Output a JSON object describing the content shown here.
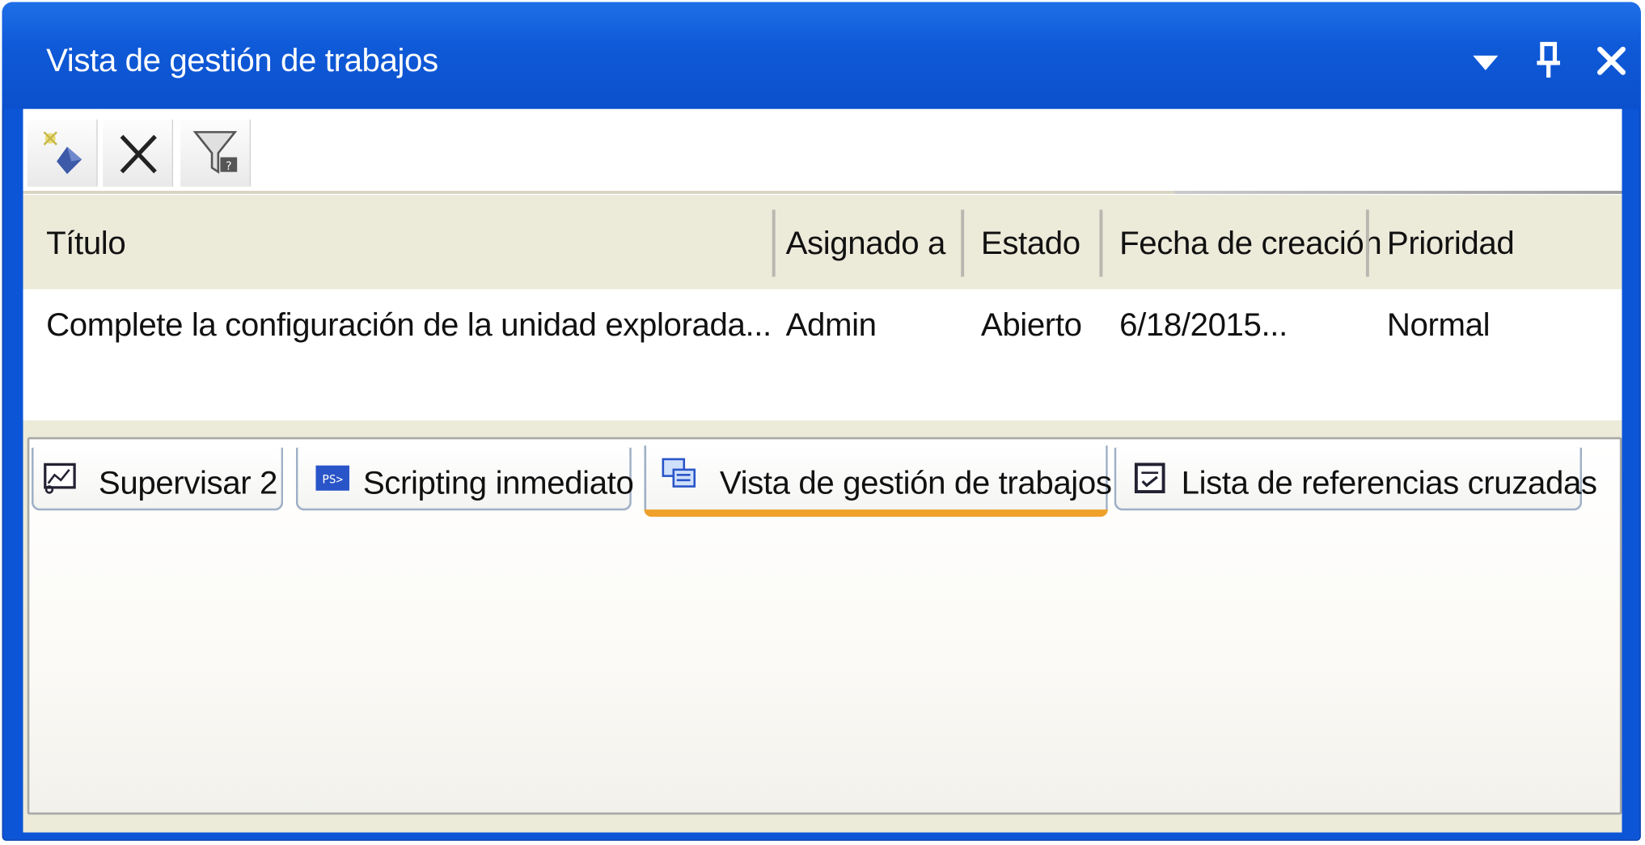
{
  "window": {
    "title": "Vista de gestión de trabajos",
    "controls": [
      "dropdown-icon",
      "pin-icon",
      "close-icon"
    ]
  },
  "toolbar": {
    "tools": [
      {
        "name": "new-job-icon"
      },
      {
        "name": "delete-icon"
      },
      {
        "name": "filter-icon"
      }
    ]
  },
  "grid": {
    "columns": [
      "Título",
      "Asignado a",
      "Estado",
      "Fecha de creación",
      "Prioridad"
    ],
    "rows": [
      {
        "title": "Complete la configuración de la unidad explorada...",
        "assigned": "Admin",
        "status": "Abierto",
        "created": "6/18/2015...",
        "priority": "Normal"
      }
    ]
  },
  "tabs": [
    {
      "label": "Supervisar 2",
      "icon": "monitor-icon",
      "active": false
    },
    {
      "label": "Scripting inmediato",
      "icon": "script-icon",
      "active": false
    },
    {
      "label": "Vista de gestión de trabajos",
      "icon": "job-management-icon",
      "active": true
    },
    {
      "label": "Lista de referencias cruzadas",
      "icon": "cross-reference-icon",
      "active": false
    }
  ],
  "colors": {
    "titlebar": "#0c55d6",
    "header_bg": "#ecead9",
    "active_tab_accent": "#f0a12a"
  }
}
